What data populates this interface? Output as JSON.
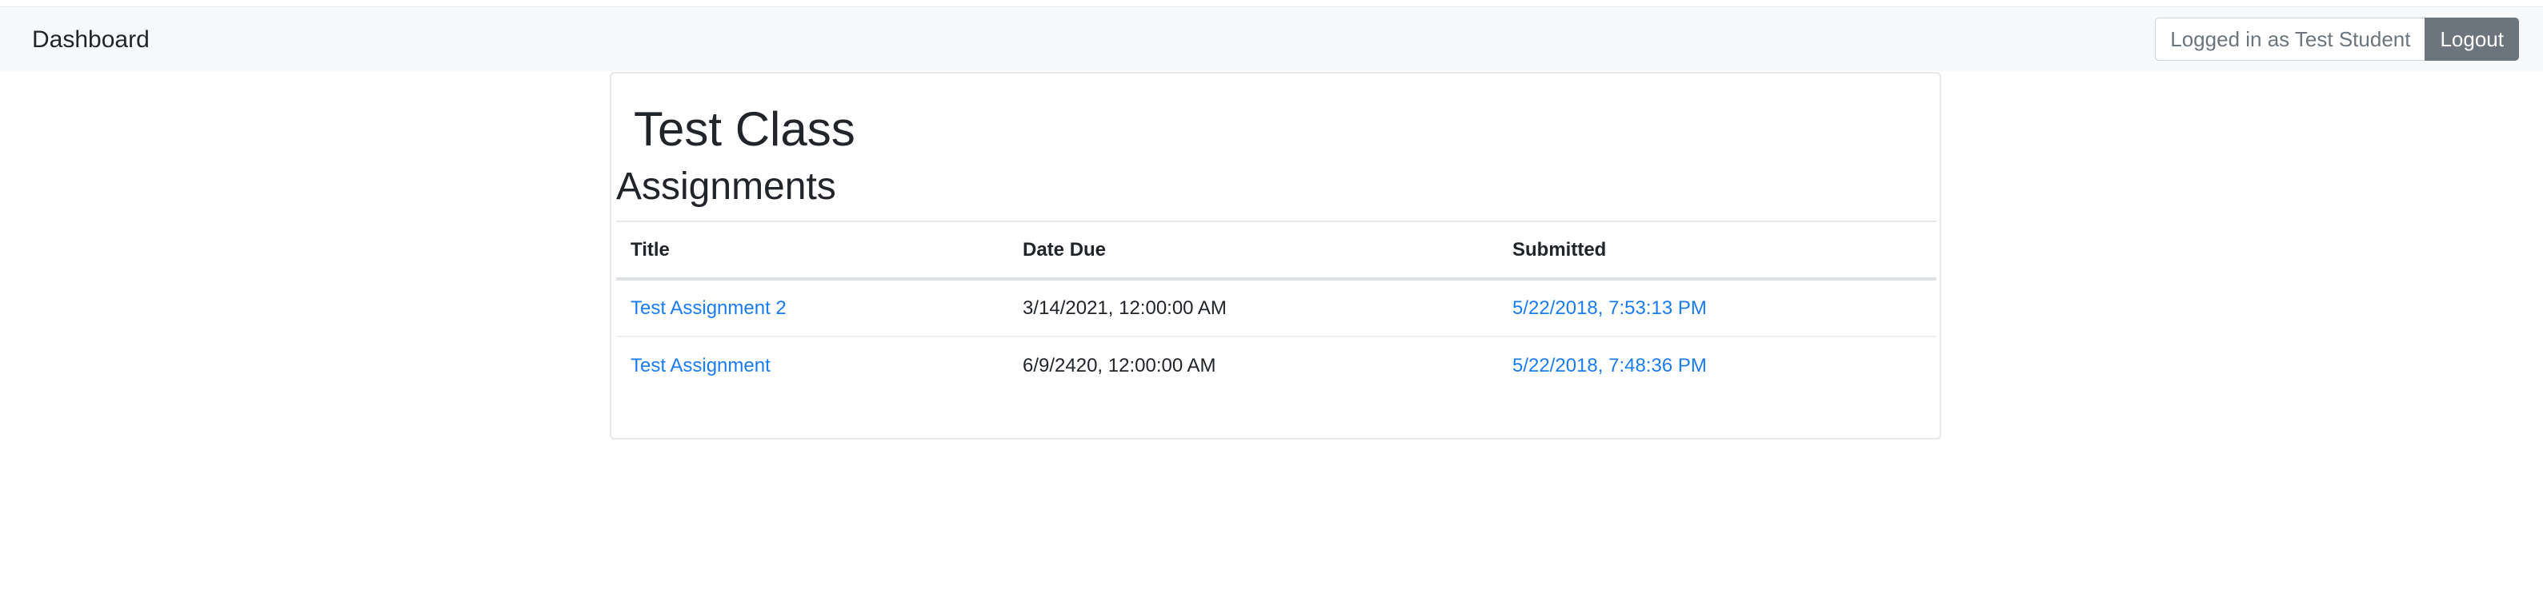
{
  "navbar": {
    "brand": "Dashboard",
    "logged_in_text": "Logged in as Test Student",
    "logout_label": "Logout"
  },
  "page": {
    "class_title": "Test Class",
    "section_title": "Assignments"
  },
  "table": {
    "headers": {
      "title": "Title",
      "date_due": "Date Due",
      "submitted": "Submitted"
    },
    "rows": [
      {
        "title": "Test Assignment 2",
        "date_due": "3/14/2021, 12:00:00 AM",
        "submitted": "5/22/2018, 7:53:13 PM"
      },
      {
        "title": "Test Assignment",
        "date_due": "6/9/2420, 12:00:00 AM",
        "submitted": "5/22/2018, 7:48:36 PM"
      }
    ]
  },
  "colors": {
    "navbar_bg": "#f8f9fa",
    "link": "#1a7cf3",
    "logout_button": "#6c757d"
  }
}
